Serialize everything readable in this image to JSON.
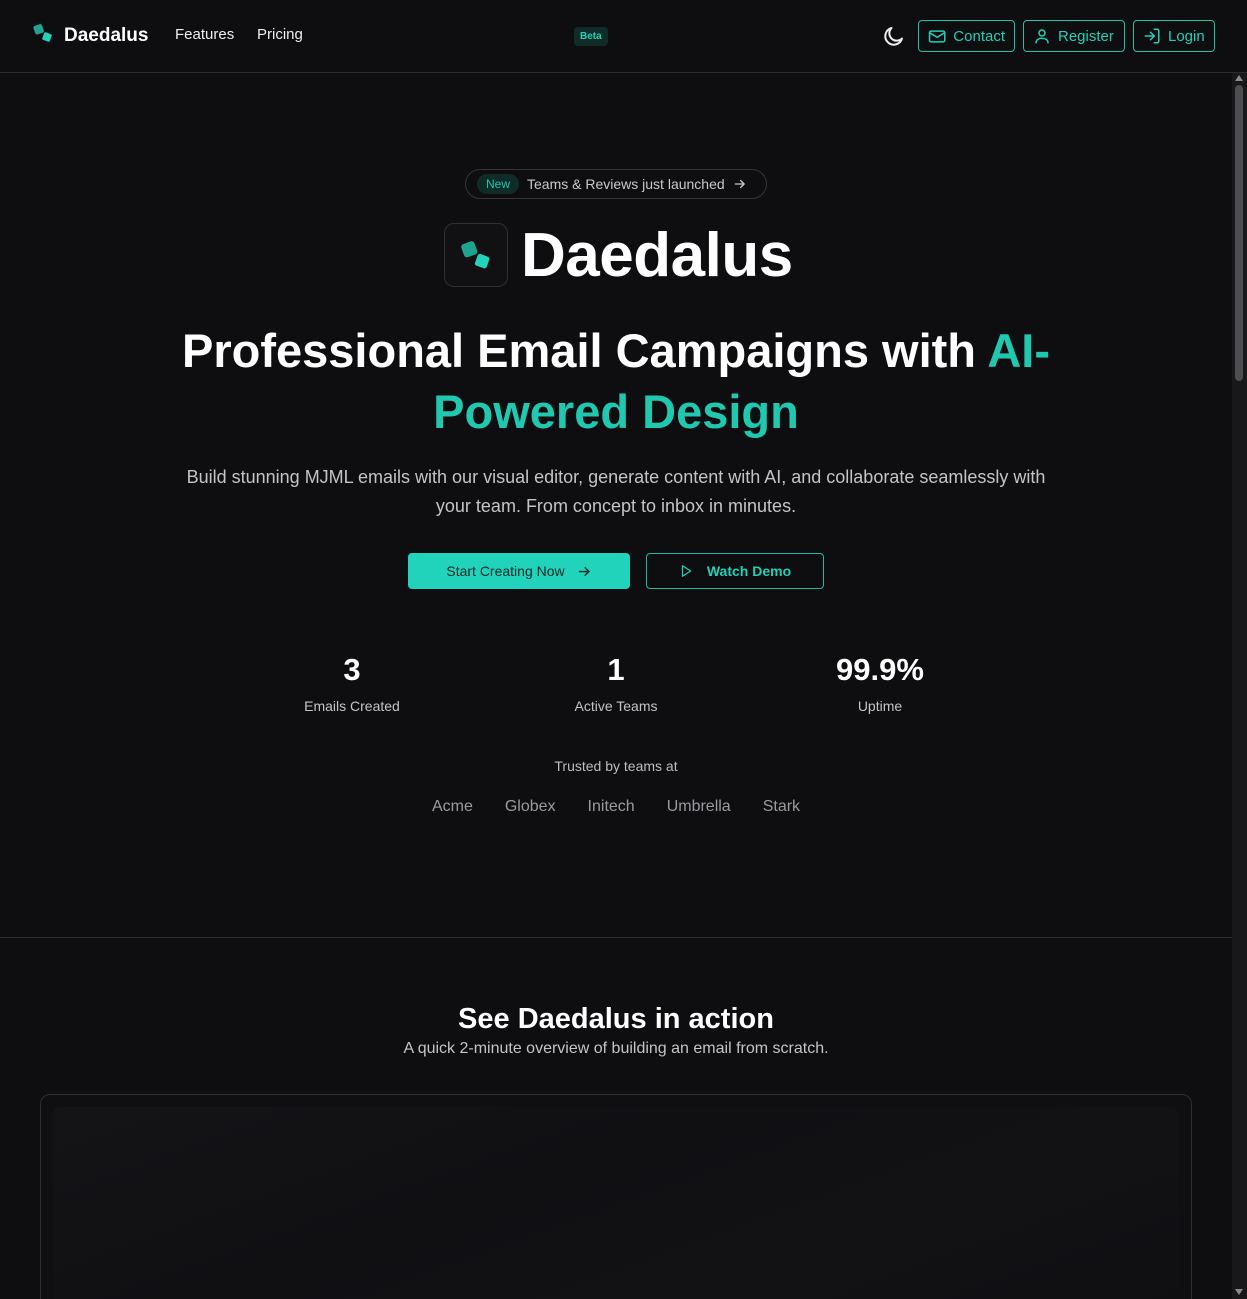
{
  "nav": {
    "brand": "Daedalus",
    "links": [
      "Features",
      "Pricing"
    ],
    "beta_badge": "Beta",
    "contact": "Contact",
    "register": "Register",
    "login": "Login"
  },
  "hero": {
    "announce_badge": "New",
    "announce_text": "Teams & Reviews just launched",
    "title": "Daedalus",
    "headline_plain": "Professional Email Campaigns with ",
    "headline_accent": "AI-Powered Design",
    "subtext": "Build stunning MJML emails with our visual editor, generate content with AI, and collaborate seamlessly with your team. From concept to inbox in minutes.",
    "cta_primary": "Start Creating Now",
    "cta_secondary": "Watch Demo"
  },
  "stats": [
    {
      "value": "3",
      "label": "Emails Created"
    },
    {
      "value": "1",
      "label": "Active Teams"
    },
    {
      "value": "99.9%",
      "label": "Uptime"
    }
  ],
  "trusted": {
    "label": "Trusted by teams at",
    "companies": [
      "Acme",
      "Globex",
      "Initech",
      "Umbrella",
      "Stark"
    ]
  },
  "demo_section": {
    "title": "See Daedalus in action",
    "subtitle": "A quick 2-minute overview of building an email from scratch."
  },
  "colors": {
    "accent": "#21d0b7",
    "background": "#0e0e11",
    "border": "#2a2a2f"
  },
  "icons": [
    "logo-icon",
    "moon-icon",
    "mail-icon",
    "user-icon",
    "login-icon",
    "arrow-right-icon",
    "play-icon"
  ]
}
